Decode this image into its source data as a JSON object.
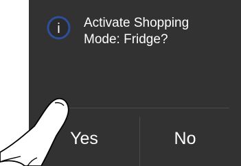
{
  "dialog": {
    "icon": "info-icon",
    "message_line1": "Activate Shopping",
    "message_line2": "Mode: Fridge?",
    "yes_label": "Yes",
    "no_label": "No"
  },
  "colors": {
    "panel_bg": "#323232",
    "icon_ring": "#2f4f9a",
    "text": "#ffffff",
    "divider": "#4a4a4a"
  },
  "overlay": {
    "icon": "pointing-hand-icon"
  }
}
